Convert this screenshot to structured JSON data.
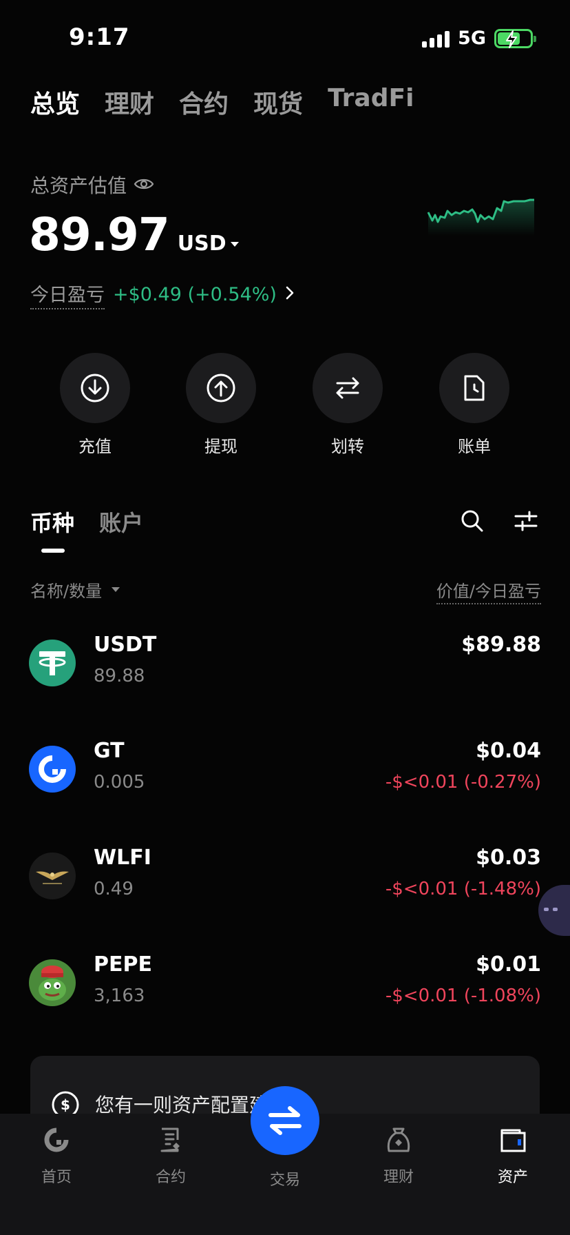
{
  "status_bar": {
    "time": "9:17",
    "network": "5G"
  },
  "top_tabs": [
    {
      "label": "总览",
      "active": true
    },
    {
      "label": "理财",
      "active": false
    },
    {
      "label": "合约",
      "active": false
    },
    {
      "label": "现货",
      "active": false
    },
    {
      "label": "TradFi",
      "active": false
    }
  ],
  "balance": {
    "label": "总资产估值",
    "value": "89.97",
    "currency": "USD",
    "pnl_label": "今日盈亏",
    "pnl_value": "+$0.49 (+0.54%)"
  },
  "actions": [
    {
      "label": "充值",
      "icon": "deposit-icon"
    },
    {
      "label": "提现",
      "icon": "withdraw-icon"
    },
    {
      "label": "划转",
      "icon": "transfer-icon"
    },
    {
      "label": "账单",
      "icon": "bill-icon"
    }
  ],
  "list_tabs": [
    {
      "label": "币种",
      "active": true
    },
    {
      "label": "账户",
      "active": false
    }
  ],
  "columns": {
    "left": "名称/数量",
    "right": "价值/今日盈亏"
  },
  "coins": [
    {
      "symbol": "USDT",
      "qty": "89.88",
      "value": "$89.88",
      "pnl": ""
    },
    {
      "symbol": "GT",
      "qty": "0.005",
      "value": "$0.04",
      "pnl": "-$<0.01 (-0.27%)"
    },
    {
      "symbol": "WLFI",
      "qty": "0.49",
      "value": "$0.03",
      "pnl": "-$<0.01 (-1.48%)"
    },
    {
      "symbol": "PEPE",
      "qty": "3,163",
      "value": "$0.01",
      "pnl": "-$<0.01 (-1.08%)"
    }
  ],
  "suggestion": {
    "text": "您有一则资产配置建议"
  },
  "bottom_nav": [
    {
      "label": "首页",
      "icon": "home-icon",
      "active": false
    },
    {
      "label": "合约",
      "icon": "contract-icon",
      "active": false
    },
    {
      "label": "交易",
      "icon": "trade-icon",
      "active": false
    },
    {
      "label": "理财",
      "icon": "finance-icon",
      "active": false
    },
    {
      "label": "资产",
      "icon": "wallet-icon",
      "active": true
    }
  ],
  "colors": {
    "positive": "#2ebd85",
    "negative": "#f0455c",
    "accent": "#1866ff"
  }
}
